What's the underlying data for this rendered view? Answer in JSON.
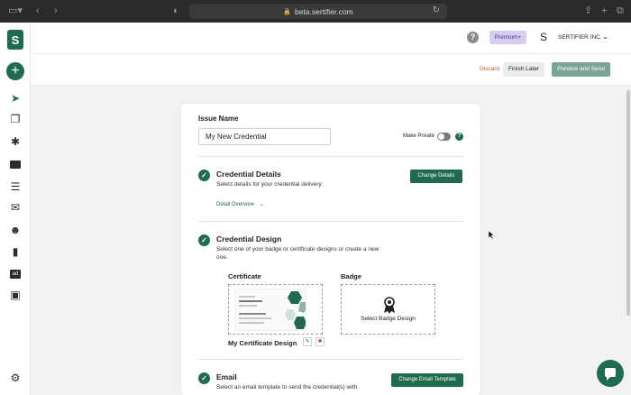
{
  "browser": {
    "url": "beta.sertifier.com"
  },
  "sidebar": {
    "logo": "S",
    "add_label": "+",
    "icons": [
      "send-icon",
      "copy-icon",
      "puzzle-icon",
      "screen-icon",
      "list-icon",
      "mail-icon",
      "users-icon",
      "chart-icon",
      "ad-icon",
      "gift-icon",
      "gear-icon"
    ],
    "ad_text": "ad"
  },
  "header": {
    "help": "?",
    "premium": "Premium+",
    "avatar": "S",
    "company": "SERTIFIER INC."
  },
  "actions": {
    "discard": "Discard",
    "finish_later": "Finish Later",
    "preview_send": "Preview and Send"
  },
  "form": {
    "issue_name_label": "Issue Name",
    "issue_name_value": "My New Credential",
    "make_private": "Make Private",
    "info": "?",
    "details": {
      "title": "Credential Details",
      "desc": "Select details for your credential delivery.",
      "button": "Change Details",
      "overview": "Detail Overview"
    },
    "design": {
      "title": "Credential Design",
      "desc": "Select one of your badge or certificate designs or create a new one.",
      "certificate_label": "Certificate",
      "badge_label": "Badge",
      "badge_select": "Select Badge Design",
      "certificate_name": "My Certificate Design"
    },
    "email": {
      "title": "Email",
      "desc": "Select an email template to send the credential(s) with.",
      "button": "Change Email Template"
    }
  },
  "colors": {
    "brand_green": "#1f6b4e",
    "premium_bg": "#d9ccf2",
    "discard": "#b0582f"
  }
}
